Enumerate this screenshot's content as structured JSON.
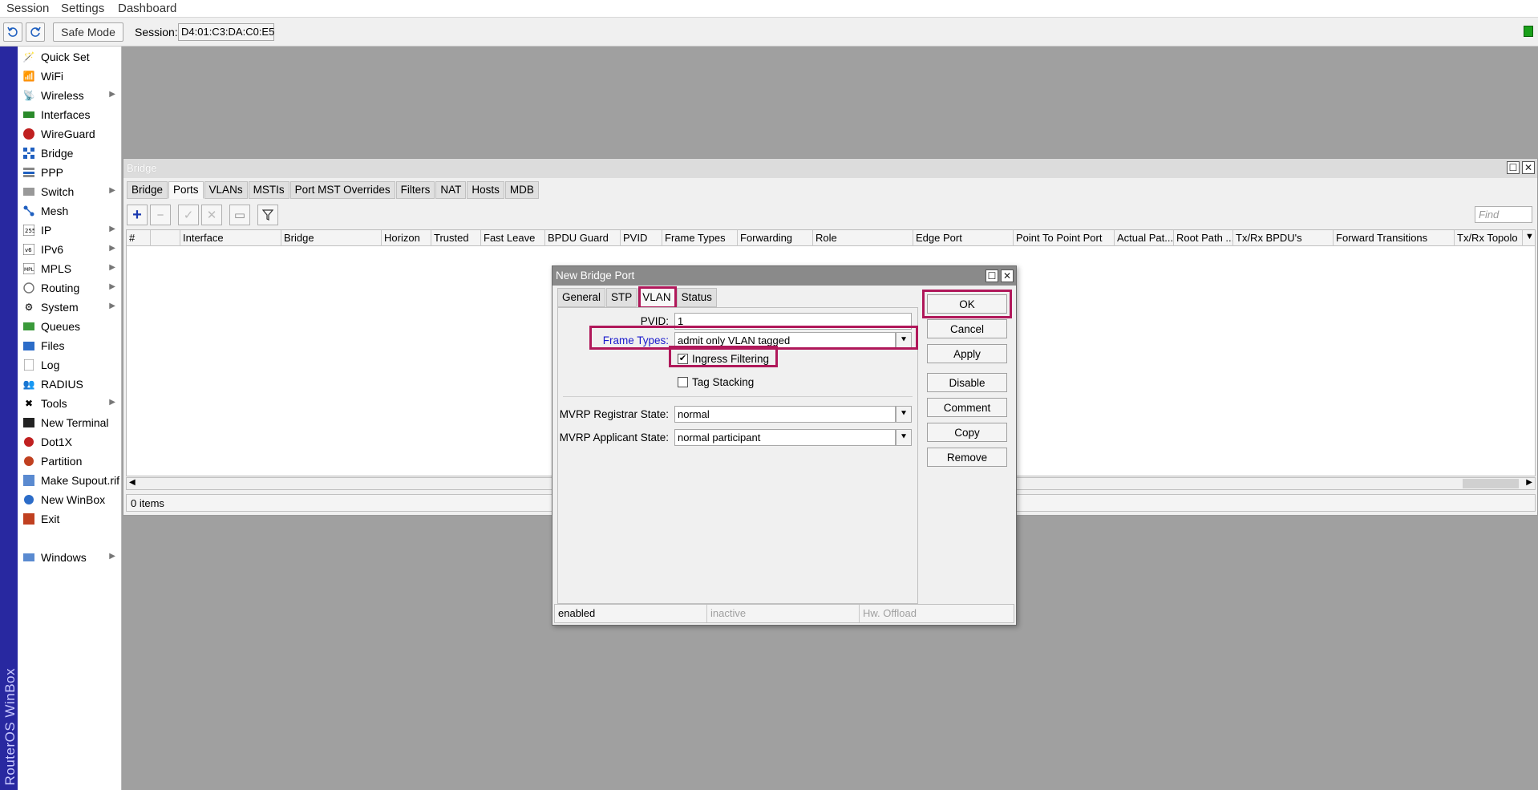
{
  "menubar": {
    "items": [
      "Session",
      "Settings",
      "Dashboard"
    ]
  },
  "toolbar": {
    "undo_icon": "undo-icon",
    "redo_icon": "redo-icon",
    "safe_mode_label": "Safe Mode",
    "session_label": "Session:",
    "session_value": "D4:01:C3:DA:C0:E5"
  },
  "brand": {
    "text": "RouterOS WinBox"
  },
  "sidebar": {
    "items": [
      {
        "label": "Quick Set",
        "icon": "quickset-icon",
        "submenu": false
      },
      {
        "label": "WiFi",
        "icon": "wifi-icon",
        "submenu": false
      },
      {
        "label": "Wireless",
        "icon": "wireless-icon",
        "submenu": true
      },
      {
        "label": "Interfaces",
        "icon": "interfaces-icon",
        "submenu": false
      },
      {
        "label": "WireGuard",
        "icon": "wireguard-icon",
        "submenu": false
      },
      {
        "label": "Bridge",
        "icon": "bridge-icon",
        "submenu": false
      },
      {
        "label": "PPP",
        "icon": "ppp-icon",
        "submenu": false
      },
      {
        "label": "Switch",
        "icon": "switch-icon",
        "submenu": true
      },
      {
        "label": "Mesh",
        "icon": "mesh-icon",
        "submenu": false
      },
      {
        "label": "IP",
        "icon": "ip-icon",
        "submenu": true
      },
      {
        "label": "IPv6",
        "icon": "ipv6-icon",
        "submenu": true
      },
      {
        "label": "MPLS",
        "icon": "mpls-icon",
        "submenu": true
      },
      {
        "label": "Routing",
        "icon": "routing-icon",
        "submenu": true
      },
      {
        "label": "System",
        "icon": "system-icon",
        "submenu": true
      },
      {
        "label": "Queues",
        "icon": "queues-icon",
        "submenu": false
      },
      {
        "label": "Files",
        "icon": "files-icon",
        "submenu": false
      },
      {
        "label": "Log",
        "icon": "log-icon",
        "submenu": false
      },
      {
        "label": "RADIUS",
        "icon": "radius-icon",
        "submenu": false
      },
      {
        "label": "Tools",
        "icon": "tools-icon",
        "submenu": true
      },
      {
        "label": "New Terminal",
        "icon": "terminal-icon",
        "submenu": false
      },
      {
        "label": "Dot1X",
        "icon": "dot1x-icon",
        "submenu": false
      },
      {
        "label": "Partition",
        "icon": "partition-icon",
        "submenu": false
      },
      {
        "label": "Make Supout.rif",
        "icon": "supout-icon",
        "submenu": false
      },
      {
        "label": "New WinBox",
        "icon": "winbox-icon",
        "submenu": false
      },
      {
        "label": "Exit",
        "icon": "exit-icon",
        "submenu": false
      },
      {
        "label": "Windows",
        "icon": "windows-icon",
        "submenu": true
      }
    ]
  },
  "bridge_window": {
    "title": "Bridge",
    "tabs": [
      "Bridge",
      "Ports",
      "VLANs",
      "MSTIs",
      "Port MST Overrides",
      "Filters",
      "NAT",
      "Hosts",
      "MDB"
    ],
    "active_tab": "Ports",
    "find_placeholder": "Find",
    "columns": [
      "#",
      "",
      "Interface",
      "Bridge",
      "Horizon",
      "Trusted",
      "Fast Leave",
      "BPDU Guard",
      "PVID",
      "Frame Types",
      "Forwarding",
      "Role",
      "Edge Port",
      "Point To Point Port",
      "Actual Pat...",
      "Root Path ...",
      "Tx/Rx BPDU's",
      "Forward Transitions",
      "Tx/Rx Topolo"
    ],
    "status": "0 items"
  },
  "dialog": {
    "title": "New Bridge Port",
    "tabs": [
      "General",
      "STP",
      "VLAN",
      "Status"
    ],
    "active_tab": "VLAN",
    "pvid_label": "PVID:",
    "pvid_value": "1",
    "frame_types_label": "Frame Types:",
    "frame_types_value": "admit only VLAN tagged",
    "ingress_filtering_label": "Ingress Filtering",
    "ingress_filtering_checked": true,
    "tag_stacking_label": "Tag Stacking",
    "tag_stacking_checked": false,
    "mvrp_registrar_label": "MVRP Registrar State:",
    "mvrp_registrar_value": "normal",
    "mvrp_applicant_label": "MVRP Applicant State:",
    "mvrp_applicant_value": "normal participant",
    "buttons": [
      "OK",
      "Cancel",
      "Apply",
      "Disable",
      "Comment",
      "Copy",
      "Remove"
    ],
    "status": [
      "enabled",
      "inactive",
      "Hw. Offload"
    ]
  },
  "colors": {
    "highlight": "#b0185a",
    "brand_bar": "#2828a0",
    "link_label": "#1a1acc",
    "status_led": "#1aa01a"
  }
}
